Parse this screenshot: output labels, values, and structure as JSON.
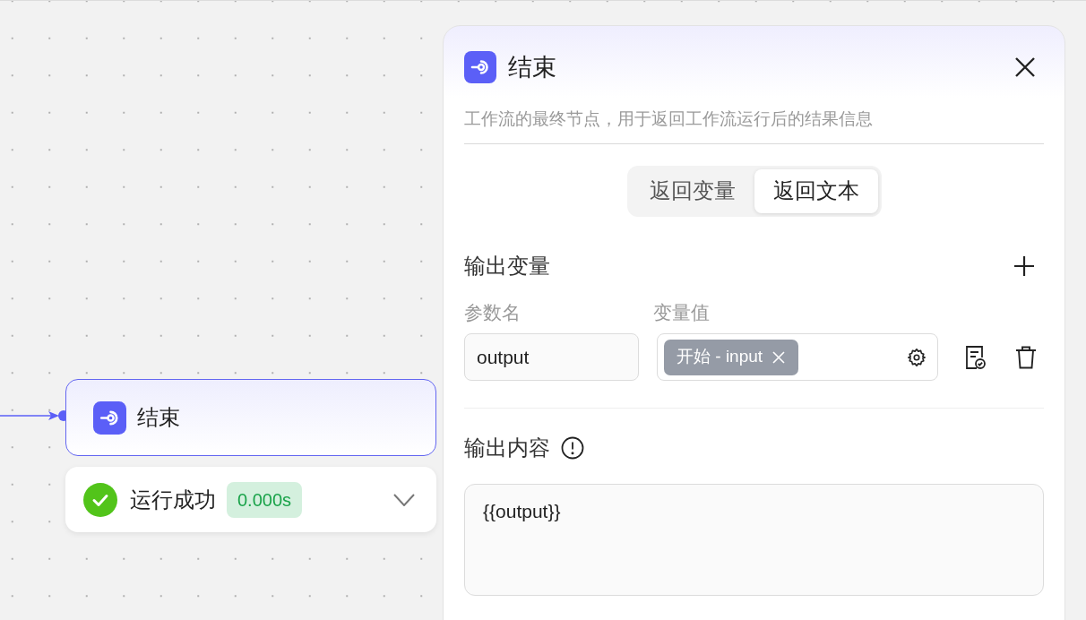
{
  "canvas": {
    "node": {
      "title": "结束",
      "status": {
        "kind": "success",
        "label": "运行成功",
        "duration": "0.000s",
        "expanded": false
      }
    }
  },
  "panel": {
    "title": "结束",
    "description": "工作流的最终节点，用于返回工作流运行后的结果信息",
    "tabs": [
      {
        "label": "返回变量",
        "selected": false
      },
      {
        "label": "返回文本",
        "selected": true
      }
    ],
    "output_variables": {
      "title": "输出变量",
      "columns": [
        "参数名",
        "变量值"
      ],
      "rows": [
        {
          "name": "output",
          "value_tag": "开始 - input"
        }
      ]
    },
    "output_content": {
      "title": "输出内容",
      "value": "{{output}}"
    }
  }
}
